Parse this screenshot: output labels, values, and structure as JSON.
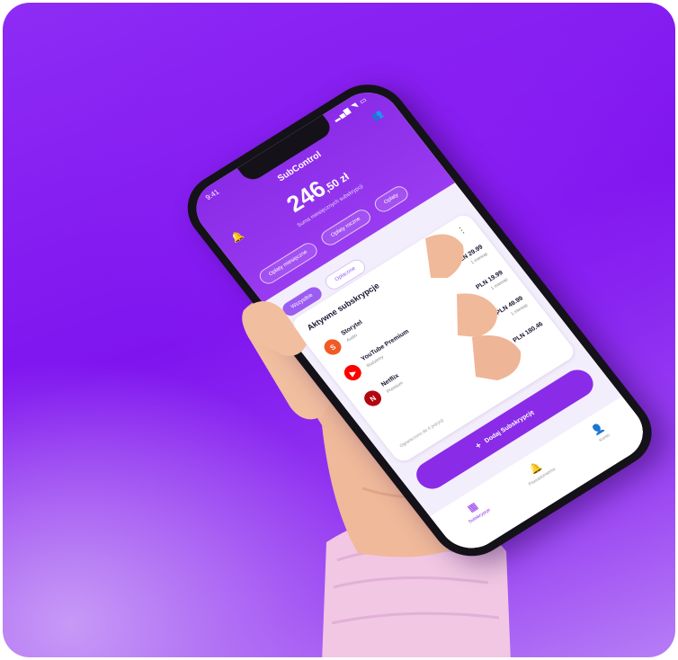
{
  "status": {
    "time": "9:41",
    "icons": "▂▄▆ ◥ ▭"
  },
  "app": {
    "title": "SubControl"
  },
  "total": {
    "main": "246",
    "decimal": ",50 zł",
    "subtitle": "Suma miesięcznych subskrypcji"
  },
  "header_chips": [
    "Opłaty miesięczne",
    "Opłaty roczne",
    "Opłaty"
  ],
  "filters": [
    {
      "label": "Wszystkie",
      "active": true
    },
    {
      "label": "Opłacone",
      "active": false
    },
    {
      "label": "Nieopłacone",
      "active": false
    }
  ],
  "panel": {
    "title": "Aktywne subskrypcje",
    "items": [
      {
        "name": "Storytel",
        "plan": "Audio",
        "price": "PLN 29.99",
        "cycle": "1 miesiąc",
        "logo_color": "#f15a24",
        "logo_glyph": "S"
      },
      {
        "name": "YouTube Premium",
        "plan": "Rodzinny",
        "price": "PLN 19.99",
        "cycle": "1 miesiąc",
        "logo_color": "#ff0000",
        "logo_glyph": "▶"
      },
      {
        "name": "Netflix",
        "plan": "Premium",
        "price": "PLN 49.99",
        "cycle": "1 miesiąc",
        "logo_color": "#b20710",
        "logo_glyph": "N"
      },
      {
        "name": "",
        "plan": "",
        "price": "PLN 180.46",
        "cycle": "",
        "logo_color": "#ffffff",
        "logo_glyph": ""
      }
    ],
    "footnote": "Ograniczono do 4 pozycji"
  },
  "add_button": {
    "icon": "+",
    "label": "Dodaj Subskrypcję"
  },
  "nav": [
    {
      "label": "Subskrypcje",
      "icon": "▦",
      "active": true
    },
    {
      "label": "Powiadomienia",
      "icon": "🔔",
      "active": false
    },
    {
      "label": "Konto",
      "icon": "👤",
      "active": false
    }
  ],
  "colors": {
    "accent": "#8a2be8",
    "background": "#8e2cf5"
  }
}
